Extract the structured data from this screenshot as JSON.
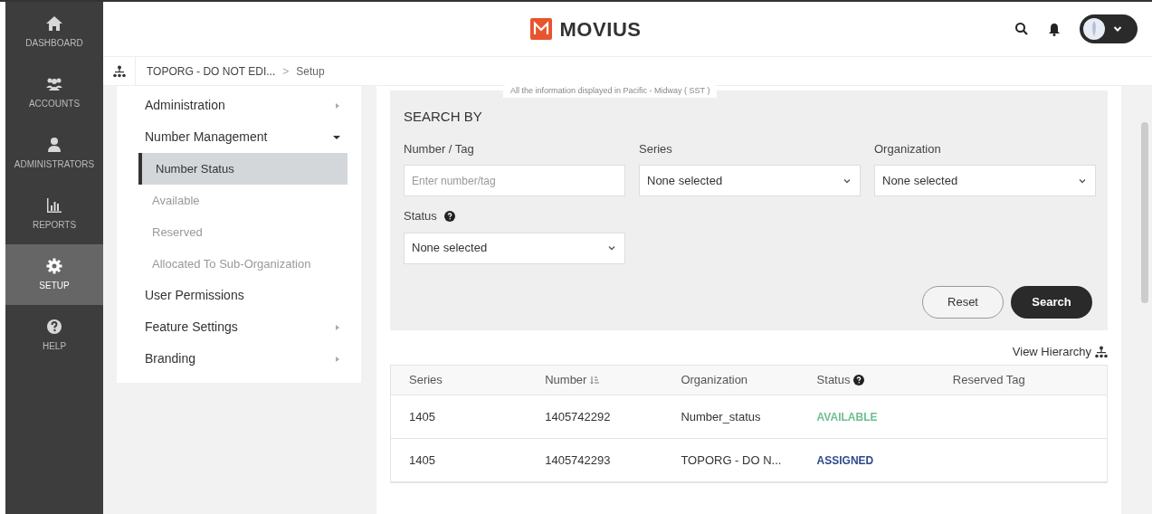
{
  "nav": [
    {
      "kind": "home",
      "label": "DASHBOARD",
      "selected": false
    },
    {
      "kind": "users",
      "label": "ACCOUNTS",
      "selected": false
    },
    {
      "kind": "admin",
      "label": "ADMINISTRATORS",
      "selected": false
    },
    {
      "kind": "chart",
      "label": "REPORTS",
      "selected": false
    },
    {
      "kind": "gear",
      "label": "SETUP",
      "selected": true
    },
    {
      "kind": "help",
      "label": "HELP",
      "selected": false
    }
  ],
  "header": {
    "logo": "MOVIUS"
  },
  "breadcrumb": {
    "parent": "TOPORG - DO NOT EDI...",
    "separator": ">",
    "current": "Setup"
  },
  "submenu": [
    {
      "label": "Administration",
      "kind": "group",
      "expanded": false,
      "selected": false
    },
    {
      "label": "Number Management",
      "kind": "group",
      "expanded": true,
      "selected": false,
      "children": [
        {
          "label": "Number Status",
          "selected": true
        },
        {
          "label": "Available",
          "selected": false
        },
        {
          "label": "Reserved",
          "selected": false
        },
        {
          "label": "Allocated To Sub-Organization",
          "selected": false
        }
      ]
    },
    {
      "label": "User Permissions",
      "kind": "link",
      "selected": false
    },
    {
      "label": "Feature Settings",
      "kind": "group",
      "expanded": false,
      "selected": false
    },
    {
      "label": "Branding",
      "kind": "group",
      "expanded": false,
      "selected": false
    }
  ],
  "timezone_note": "All the information displayed in Pacific - Midway ( SST )",
  "search": {
    "title": "SEARCH BY",
    "fields": [
      {
        "kind": "text",
        "label": "Number / Tag",
        "placeholder": "Enter number/tag",
        "help": false
      },
      {
        "kind": "select",
        "label": "Series",
        "value": "None selected",
        "help": false
      },
      {
        "kind": "select",
        "label": "Organization",
        "value": "None selected",
        "help": false
      },
      {
        "kind": "select",
        "label": "Status",
        "value": "None selected",
        "help": true
      }
    ],
    "buttons": [
      "Reset",
      "Search"
    ]
  },
  "view_hierarchy": "View Hierarchy",
  "table": {
    "columns": [
      {
        "label": "Series",
        "sort": false,
        "help": false
      },
      {
        "label": "Number",
        "sort": true,
        "help": false
      },
      {
        "label": "Organization",
        "sort": false,
        "help": false
      },
      {
        "label": "Status",
        "sort": false,
        "help": true
      },
      {
        "label": "Reserved Tag",
        "sort": false,
        "help": false
      }
    ],
    "rows": [
      {
        "series": "1405",
        "number": "1405742292",
        "organization": "Number_status",
        "status": "AVAILABLE",
        "color": "#6dbf8f"
      },
      {
        "series": "1405",
        "number": "1405742293",
        "organization": "TOPORG - DO N...",
        "status": "ASSIGNED",
        "color": "#2e4a8c"
      }
    ]
  }
}
